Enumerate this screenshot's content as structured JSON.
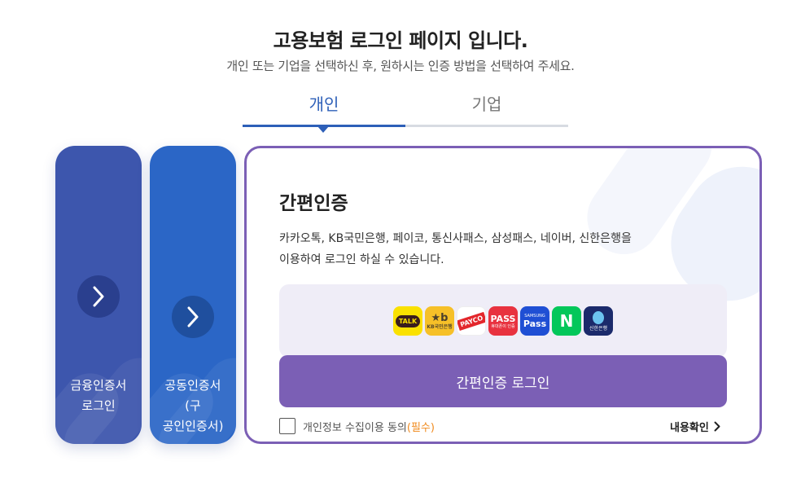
{
  "header": {
    "title": "고용보험 로그인 페이지 입니다.",
    "subtitle": "개인 또는 기업을 선택하신 후, 원하시는 인증 방법을 선택하여 주세요."
  },
  "tabs": [
    {
      "label": "개인",
      "active": true
    },
    {
      "label": "기업",
      "active": false
    }
  ],
  "side_cards": {
    "financial": {
      "line1": "금융인증서",
      "line2": "로그인"
    },
    "joint": {
      "line1": "공동인증서",
      "line2": "(구",
      "line3": "공인인증서)"
    }
  },
  "simple_auth": {
    "title": "간편인증",
    "desc_line1": "카카오톡, KB국민은행, 페이코, 통신사패스, 삼성패스, 네이버, 신한은행을",
    "desc_line2": "이용하여 로그인 하실 수 있습니다.",
    "providers": {
      "kakao": "TALK",
      "kb_big": "★b",
      "kb_small": "KB국민은행",
      "payco": "PAYCO",
      "pass": "PASS",
      "pass_small": "휴대폰이 인증",
      "samsung_small": "SAMSUNG",
      "samsung": "Pass",
      "naver": "N",
      "shinhan_small": "신한은행"
    },
    "login_button": "간편인증 로그인",
    "consent_label": "개인정보 수집이용 동의",
    "consent_required": "(필수)",
    "detail_link": "내용확인"
  },
  "colors": {
    "accent_blue": "#2d5fb8",
    "financial_card": "#3d56ad",
    "joint_card": "#2b66c6",
    "purple": "#7b5fb5",
    "required_orange": "#f08a1d"
  }
}
